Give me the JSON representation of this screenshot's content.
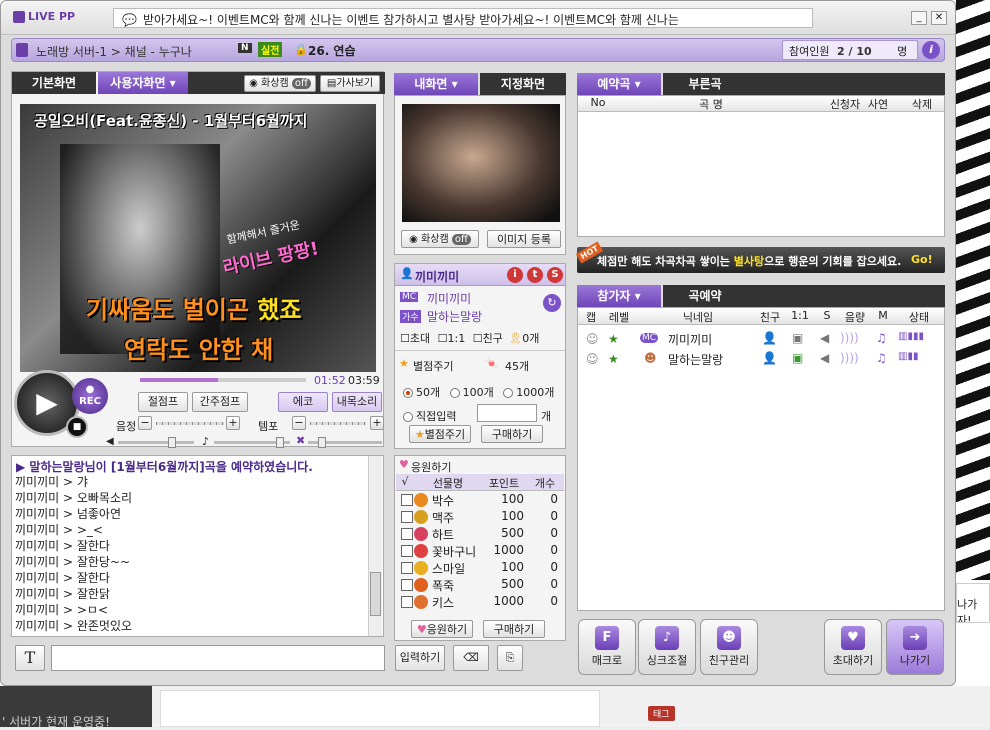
{
  "app": {
    "logo": "LIVE PP"
  },
  "ticker": {
    "text": "받아가세요~!          이벤트MC와 함께 신나는 이벤트 참가하시고 별사탕 받아가세요~!          이벤트MC와 함께 신나는"
  },
  "window": {
    "minimize": "_",
    "close": "✕"
  },
  "room": {
    "path": "노래방 서버-1 > 채널 - 누구나",
    "badge_n": "N",
    "badge_state": "실전",
    "lock_title": "26. 연습",
    "participants_label": "참여인원",
    "participants": "2 / 10",
    "unit": "명",
    "info": "i"
  },
  "left": {
    "tab_basic": "기본화면",
    "tab_user": "사용자화면",
    "cam_label": "화상캠",
    "cam_state": "off",
    "lyrics_btn": "가사보기",
    "song_title": "공일오비(Feat.윤종신) - 1월부터6월까지",
    "lyric1_a": "기싸움도 ",
    "lyric1_b": "벌이곤 ",
    "lyric1_c": "했죠",
    "lyric2": "연락도 안한 채",
    "overlay1": "함께해서 즐거운",
    "overlay2": "라이브 팡팡!",
    "time_now": "01:52",
    "time_total": "03:59",
    "rec": "REC",
    "btn_jeoljeom": "절점프",
    "btn_ganju": "간주점프",
    "btn_echo": "에코",
    "btn_myvoice": "내목소리",
    "label_pitch": "음정",
    "label_tempo": "템포"
  },
  "chat": {
    "notice": "말하는말랑님이 [1월부터6월까지]곡을 예약하였습니다.",
    "lines": [
      "끼미끼미 > 갸",
      "끼미끼미 > 오빠목소리",
      "끼미끼미 > 넘좋아연",
      "끼미끼미 > >_<",
      "끼미끼미 > 잘한다",
      "끼미끼미 > 잘한당~~",
      "끼미끼미 > 잘한다",
      "끼미끼미 > 잘한닭",
      "끼미끼미 > >ㅁ<",
      "끼미끼미 > 완존멋있오"
    ],
    "enter_btn": "입력하기",
    "font_btn": "T"
  },
  "mid": {
    "tab_my": "내화면",
    "tab_fixed": "지정화면",
    "cam_label": "화상캠",
    "cam_state": "off",
    "img_reg": "이미지 등록",
    "user_name": "끼미끼미",
    "mc_badge": "MC",
    "mc_name": "끼미끼미",
    "singer_badge": "가수",
    "singer_name": "말하는말랑",
    "chk_invite": "초대",
    "chk_11": "1:1",
    "chk_friend": "친구",
    "candy_count": "0개",
    "star_title": "별점주기",
    "star_count": "45개",
    "opt_50": "50개",
    "opt_100": "100개",
    "opt_1000": "1000개",
    "opt_direct": "직접입력",
    "opt_unit": "개",
    "btn_give_star": "별점주기",
    "btn_buy": "구매하기",
    "cheer_title": "응원하기",
    "gift_headers": [
      "√",
      "선물명",
      "포인트",
      "개수"
    ],
    "gifts": [
      {
        "name": "박수",
        "point": "100",
        "count": "0",
        "color": "#e88a20"
      },
      {
        "name": "맥주",
        "point": "100",
        "count": "0",
        "color": "#d8a020"
      },
      {
        "name": "하트",
        "point": "500",
        "count": "0",
        "color": "#d84060"
      },
      {
        "name": "꽃바구니",
        "point": "1000",
        "count": "0",
        "color": "#e04040"
      },
      {
        "name": "스마일",
        "point": "100",
        "count": "0",
        "color": "#e8b020"
      },
      {
        "name": "폭죽",
        "point": "500",
        "count": "0",
        "color": "#e06020"
      },
      {
        "name": "키스",
        "point": "1000",
        "count": "0",
        "color": "#e07030"
      }
    ],
    "btn_cheer": "응원하기",
    "btn_buy2": "구매하기"
  },
  "right": {
    "tab_reserve": "예약곡",
    "tab_sung": "부른곡",
    "res_headers": [
      "No",
      "곡 명",
      "신청자",
      "사연",
      "삭제"
    ],
    "banner_hot": "HOT",
    "banner_a": "체점만 해도 차곡차곡 쌓이는 ",
    "banner_b": "별사탕",
    "banner_c": "으로 행운의 기회를 잡으세요.",
    "banner_go": "Go!",
    "tab_participants": "참가자",
    "tab_song_reserve": "곡예약",
    "p_headers": [
      "캡",
      "레벨",
      "닉네임",
      "친구",
      "1:1",
      "S",
      "음량",
      "M",
      "상태"
    ],
    "participants": [
      {
        "badge": "MC",
        "name": "끼미끼미"
      },
      {
        "badge": "",
        "name": "말하는말랑"
      }
    ],
    "big_buttons": {
      "macro": "매크로",
      "sync": "싱크조절",
      "friends": "친구관리",
      "invite": "초대하기",
      "exit": "나가기"
    }
  },
  "background": {
    "right_text": "나가자!",
    "bottom_text": "' 서버가 현재 운영중!",
    "tag": "태그"
  }
}
